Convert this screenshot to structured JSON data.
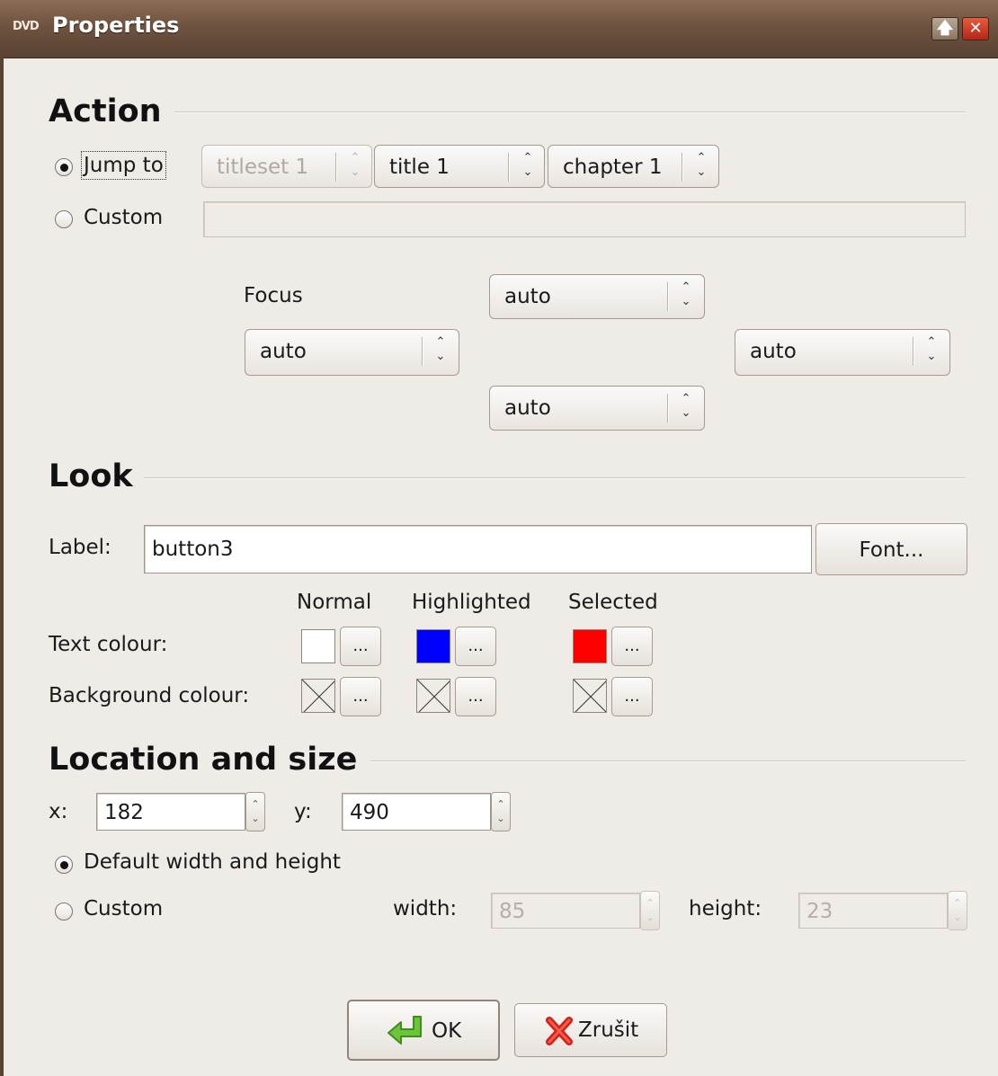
{
  "window": {
    "icon": "dvd-icon",
    "icon_text": "DVD",
    "title": "Properties",
    "maximize_glyph": "🡅",
    "close_glyph": "✕"
  },
  "action": {
    "section_title": "Action",
    "jump_to_label": "Jump to",
    "jump_selected": true,
    "titleset": "titleset 1",
    "title": "title 1",
    "chapter": "chapter 1",
    "custom_label": "Custom",
    "custom_value": "",
    "focus_label": "Focus",
    "focus_up": "auto",
    "focus_left": "auto",
    "focus_right": "auto",
    "focus_down": "auto"
  },
  "look": {
    "section_title": "Look",
    "label_label": "Label:",
    "label_value": "button3",
    "font_button": "Font...",
    "col_normal": "Normal",
    "col_highlighted": "Highlighted",
    "col_selected": "Selected",
    "text_colour_label": "Text colour:",
    "background_colour_label": "Background colour:",
    "dots": "...",
    "text_colours": {
      "normal": "#ffffff",
      "highlighted": "#0000ff",
      "selected": "#ff0000"
    }
  },
  "location": {
    "section_title": "Location and size",
    "x_label": "x:",
    "x_value": "182",
    "y_label": "y:",
    "y_value": "490",
    "default_size_label": "Default width and height",
    "default_size_selected": true,
    "custom_label": "Custom",
    "width_label": "width:",
    "width_value": "85",
    "height_label": "height:",
    "height_value": "23"
  },
  "buttons": {
    "ok": "OK",
    "ok_icon": "enter-arrow-icon",
    "cancel": "Zrušit",
    "cancel_icon": "cancel-x-icon"
  }
}
